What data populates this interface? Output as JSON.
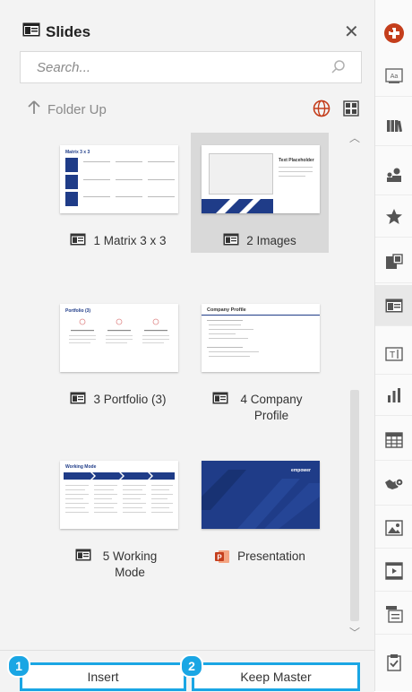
{
  "header": {
    "title": "Slides",
    "search_placeholder": "Search...",
    "folder_up_label": "Folder Up"
  },
  "tiles": [
    {
      "label": "1 Matrix 3 x 3",
      "thumb_title": "Matrix 3 x 3",
      "icon": "slide-layout-icon",
      "selected": false
    },
    {
      "label": "2 Images",
      "thumb_title": "Text Placeholder",
      "icon": "slide-layout-icon",
      "selected": true
    },
    {
      "label": "3 Portfolio (3)",
      "thumb_title": "Portfolio (3)",
      "icon": "slide-layout-icon",
      "selected": false
    },
    {
      "label": "4 Company Profile",
      "thumb_title": "Company Profile",
      "icon": "slide-layout-icon",
      "selected": false
    },
    {
      "label": "5 Working Mode",
      "thumb_title": "Working Mode",
      "icon": "slide-layout-icon",
      "selected": false
    },
    {
      "label": "Presentation",
      "thumb_title": "empower",
      "icon": "powerpoint-icon",
      "selected": false
    }
  ],
  "footer": {
    "insert_label": "Insert",
    "insert_badge": "1",
    "keep_master_label": "Keep Master",
    "keep_master_badge": "2"
  },
  "rail": {
    "items": [
      "app-logo-icon",
      "text-library-icon",
      "books-icon",
      "people-icon",
      "star-icon",
      "smartart-icon",
      "slides-icon",
      "textbox-icon",
      "chart-icon",
      "table-icon",
      "map-icon",
      "image-icon",
      "video-icon",
      "agenda-icon",
      "check-icon"
    ],
    "active": "slides-icon"
  },
  "colors": {
    "accent": "#1aa6e4",
    "brand_navy": "#1f3c88",
    "panel_bg": "#f3f3f3",
    "logo_red": "#c43e1c"
  }
}
